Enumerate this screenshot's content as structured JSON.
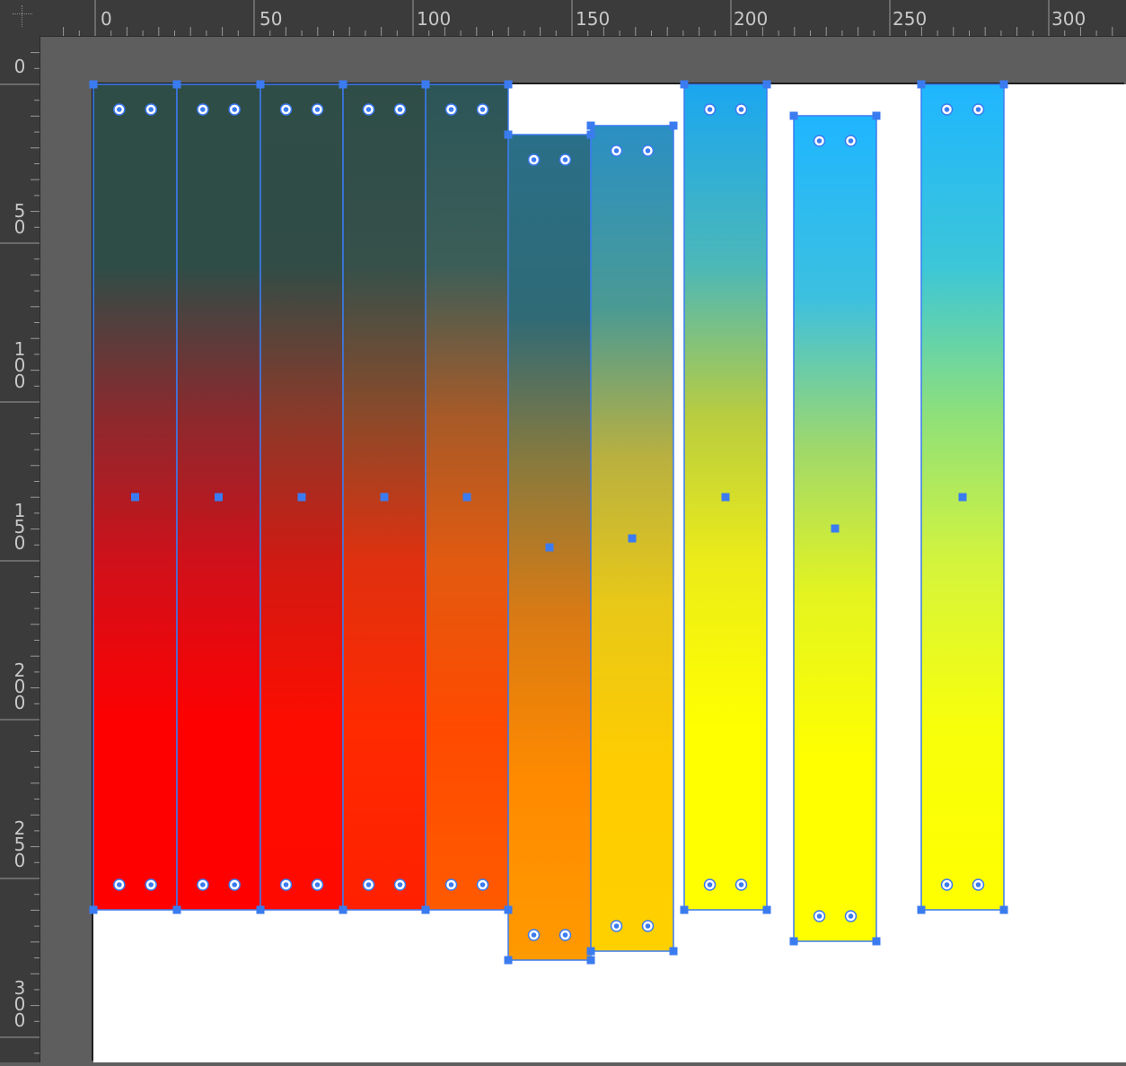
{
  "rulers": {
    "horizontal": [
      "0",
      "50",
      "100",
      "150",
      "200",
      "250",
      "300"
    ],
    "vertical": [
      "0",
      "50",
      "100",
      "150",
      "200",
      "250",
      "300"
    ]
  },
  "gradient_stops": {
    "top_dark": "#2f4d47",
    "top_mid_blue": "#2a8fc4",
    "top_blue": "#1fb6ff",
    "mid_dark_red": "#8a2a2e",
    "red": "#ff0000",
    "orange": "#ff8a00",
    "yellow": "#ffff00",
    "yellow_green": "#c8ee46"
  },
  "selection_color": "#3b7bf0",
  "strips": [
    {
      "name": "strip-1",
      "gradient": [
        "#2f4d47",
        "#2f4d47",
        "#8a2a2e",
        "#d0101a",
        "#ff0000",
        "#ff0000"
      ]
    },
    {
      "name": "strip-2",
      "gradient": [
        "#2f4d47",
        "#2f4d47",
        "#8a2a2e",
        "#d0101a",
        "#ff0000",
        "#ff0000"
      ]
    },
    {
      "name": "strip-3",
      "gradient": [
        "#2f4d47",
        "#314c46",
        "#8a3a2a",
        "#d01a12",
        "#ff0c00",
        "#ff0a00"
      ]
    },
    {
      "name": "strip-4",
      "gradient": [
        "#2f4d47",
        "#36504a",
        "#8a4a2a",
        "#e0300f",
        "#ff2a00",
        "#ff2000"
      ]
    },
    {
      "name": "strip-5",
      "gradient": [
        "#2c5558",
        "#3c5e58",
        "#a65a28",
        "#e25a10",
        "#ff4a00",
        "#ff5a00"
      ]
    },
    {
      "name": "strip-6",
      "gradient": [
        "#2a6f88",
        "#2f6a76",
        "#8a7a3c",
        "#d87a14",
        "#ff8a00",
        "#ff9a00"
      ]
    },
    {
      "name": "strip-7",
      "gradient": [
        "#2a8fc4",
        "#4a9a94",
        "#b8b040",
        "#e8c818",
        "#ffcc00",
        "#ffd000"
      ]
    },
    {
      "name": "strip-8",
      "gradient": [
        "#1aa6f0",
        "#4cb8b8",
        "#b8cc40",
        "#ecec18",
        "#ffff00",
        "#ffff00"
      ]
    },
    {
      "name": "strip-9",
      "gradient": [
        "#1fb6ff",
        "#3cc0e0",
        "#9ed86c",
        "#e4f420",
        "#ffff00",
        "#ffff00"
      ]
    },
    {
      "name": "strip-10",
      "gradient": [
        "#1fb6ff",
        "#3cc6d8",
        "#8ee07a",
        "#d4f43c",
        "#f8ff0a",
        "#ffff00"
      ]
    }
  ]
}
